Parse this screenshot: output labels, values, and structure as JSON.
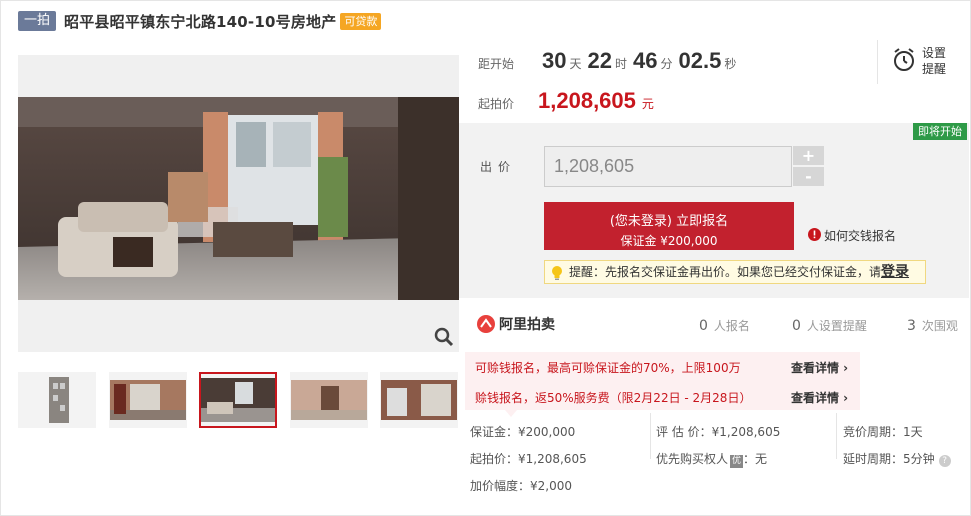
{
  "header": {
    "tag": "一拍",
    "title": "昭平县昭平镇东宁北路140-10号房地产",
    "loan_tag": "可贷款"
  },
  "countdown": {
    "label": "距开始",
    "days": "30",
    "days_unit": "天",
    "hours": "22",
    "hours_unit": "时",
    "minutes": "46",
    "minutes_unit": "分",
    "seconds": "02.5",
    "seconds_unit": "秒"
  },
  "remind": {
    "label": "设置提醒"
  },
  "start_price": {
    "label": "起拍价",
    "value": "1,208,605",
    "unit": "元"
  },
  "bid": {
    "soon_badge": "即将开始",
    "label": "出价",
    "value": "1,208,605",
    "plus": "+",
    "minus": "-",
    "signup_main": "(您未登录) 立即报名",
    "signup_sub": "保证金 ¥200,000",
    "how_pay": "如何交钱报名",
    "tip_text": "提醒：先报名交保证金再出价。如果您已经交付保证金，请",
    "tip_login": "登录"
  },
  "ali": {
    "name": "阿里拍卖",
    "signups": "0",
    "signups_label": "人报名",
    "reminders": "0",
    "reminders_label": "人设置提醒",
    "views": "3",
    "views_label": "次围观"
  },
  "promo": {
    "line1": "可赊钱报名，最高可赊保证金的70%，上限100万",
    "line1_link": "查看详情 ›",
    "line2": "赊钱报名，返50%服务费（限2月22日 - 2月28日）",
    "line2_link": "查看详情 ›"
  },
  "info": {
    "deposit": "保证金：¥200,000",
    "start_price": "起拍价：¥1,208,605",
    "increment": "加价幅度：¥2,000",
    "appraisal": "评 估 价：¥1,208,605",
    "priority_label": "优先购买权人",
    "priority_badge": "优",
    "priority_value": "：无",
    "cycle": "竞价周期：1天",
    "delay": "延时周期：5分钟"
  },
  "colors": {
    "accent": "#c8161d",
    "tag": "#6b7a99",
    "loan": "#f5a623",
    "soon": "#2e9a47"
  },
  "icons": [
    "alarm-clock-icon",
    "zoom-icon",
    "info-icon",
    "lightbulb-icon",
    "ali-auction-logo",
    "help-icon"
  ]
}
